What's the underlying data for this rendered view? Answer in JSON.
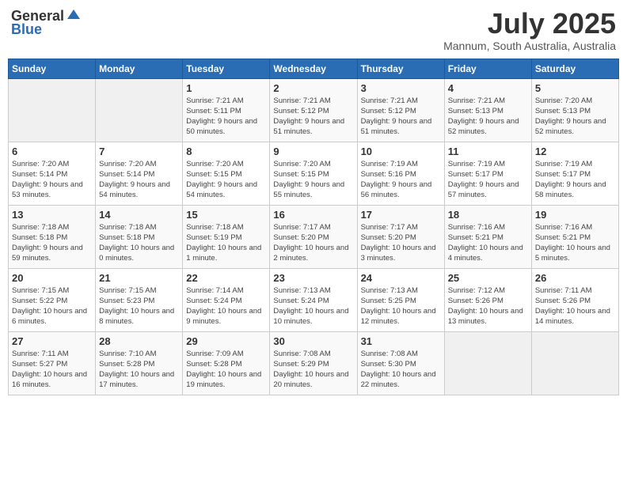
{
  "header": {
    "logo_general": "General",
    "logo_blue": "Blue",
    "month_year": "July 2025",
    "location": "Mannum, South Australia, Australia"
  },
  "days_of_week": [
    "Sunday",
    "Monday",
    "Tuesday",
    "Wednesday",
    "Thursday",
    "Friday",
    "Saturday"
  ],
  "weeks": [
    [
      {
        "day": "",
        "sunrise": "",
        "sunset": "",
        "daylight": "",
        "empty": true
      },
      {
        "day": "",
        "sunrise": "",
        "sunset": "",
        "daylight": "",
        "empty": true
      },
      {
        "day": "1",
        "sunrise": "Sunrise: 7:21 AM",
        "sunset": "Sunset: 5:11 PM",
        "daylight": "Daylight: 9 hours and 50 minutes.",
        "empty": false
      },
      {
        "day": "2",
        "sunrise": "Sunrise: 7:21 AM",
        "sunset": "Sunset: 5:12 PM",
        "daylight": "Daylight: 9 hours and 51 minutes.",
        "empty": false
      },
      {
        "day": "3",
        "sunrise": "Sunrise: 7:21 AM",
        "sunset": "Sunset: 5:12 PM",
        "daylight": "Daylight: 9 hours and 51 minutes.",
        "empty": false
      },
      {
        "day": "4",
        "sunrise": "Sunrise: 7:21 AM",
        "sunset": "Sunset: 5:13 PM",
        "daylight": "Daylight: 9 hours and 52 minutes.",
        "empty": false
      },
      {
        "day": "5",
        "sunrise": "Sunrise: 7:20 AM",
        "sunset": "Sunset: 5:13 PM",
        "daylight": "Daylight: 9 hours and 52 minutes.",
        "empty": false
      }
    ],
    [
      {
        "day": "6",
        "sunrise": "Sunrise: 7:20 AM",
        "sunset": "Sunset: 5:14 PM",
        "daylight": "Daylight: 9 hours and 53 minutes.",
        "empty": false
      },
      {
        "day": "7",
        "sunrise": "Sunrise: 7:20 AM",
        "sunset": "Sunset: 5:14 PM",
        "daylight": "Daylight: 9 hours and 54 minutes.",
        "empty": false
      },
      {
        "day": "8",
        "sunrise": "Sunrise: 7:20 AM",
        "sunset": "Sunset: 5:15 PM",
        "daylight": "Daylight: 9 hours and 54 minutes.",
        "empty": false
      },
      {
        "day": "9",
        "sunrise": "Sunrise: 7:20 AM",
        "sunset": "Sunset: 5:15 PM",
        "daylight": "Daylight: 9 hours and 55 minutes.",
        "empty": false
      },
      {
        "day": "10",
        "sunrise": "Sunrise: 7:19 AM",
        "sunset": "Sunset: 5:16 PM",
        "daylight": "Daylight: 9 hours and 56 minutes.",
        "empty": false
      },
      {
        "day": "11",
        "sunrise": "Sunrise: 7:19 AM",
        "sunset": "Sunset: 5:17 PM",
        "daylight": "Daylight: 9 hours and 57 minutes.",
        "empty": false
      },
      {
        "day": "12",
        "sunrise": "Sunrise: 7:19 AM",
        "sunset": "Sunset: 5:17 PM",
        "daylight": "Daylight: 9 hours and 58 minutes.",
        "empty": false
      }
    ],
    [
      {
        "day": "13",
        "sunrise": "Sunrise: 7:18 AM",
        "sunset": "Sunset: 5:18 PM",
        "daylight": "Daylight: 9 hours and 59 minutes.",
        "empty": false
      },
      {
        "day": "14",
        "sunrise": "Sunrise: 7:18 AM",
        "sunset": "Sunset: 5:18 PM",
        "daylight": "Daylight: 10 hours and 0 minutes.",
        "empty": false
      },
      {
        "day": "15",
        "sunrise": "Sunrise: 7:18 AM",
        "sunset": "Sunset: 5:19 PM",
        "daylight": "Daylight: 10 hours and 1 minute.",
        "empty": false
      },
      {
        "day": "16",
        "sunrise": "Sunrise: 7:17 AM",
        "sunset": "Sunset: 5:20 PM",
        "daylight": "Daylight: 10 hours and 2 minutes.",
        "empty": false
      },
      {
        "day": "17",
        "sunrise": "Sunrise: 7:17 AM",
        "sunset": "Sunset: 5:20 PM",
        "daylight": "Daylight: 10 hours and 3 minutes.",
        "empty": false
      },
      {
        "day": "18",
        "sunrise": "Sunrise: 7:16 AM",
        "sunset": "Sunset: 5:21 PM",
        "daylight": "Daylight: 10 hours and 4 minutes.",
        "empty": false
      },
      {
        "day": "19",
        "sunrise": "Sunrise: 7:16 AM",
        "sunset": "Sunset: 5:21 PM",
        "daylight": "Daylight: 10 hours and 5 minutes.",
        "empty": false
      }
    ],
    [
      {
        "day": "20",
        "sunrise": "Sunrise: 7:15 AM",
        "sunset": "Sunset: 5:22 PM",
        "daylight": "Daylight: 10 hours and 6 minutes.",
        "empty": false
      },
      {
        "day": "21",
        "sunrise": "Sunrise: 7:15 AM",
        "sunset": "Sunset: 5:23 PM",
        "daylight": "Daylight: 10 hours and 8 minutes.",
        "empty": false
      },
      {
        "day": "22",
        "sunrise": "Sunrise: 7:14 AM",
        "sunset": "Sunset: 5:24 PM",
        "daylight": "Daylight: 10 hours and 9 minutes.",
        "empty": false
      },
      {
        "day": "23",
        "sunrise": "Sunrise: 7:13 AM",
        "sunset": "Sunset: 5:24 PM",
        "daylight": "Daylight: 10 hours and 10 minutes.",
        "empty": false
      },
      {
        "day": "24",
        "sunrise": "Sunrise: 7:13 AM",
        "sunset": "Sunset: 5:25 PM",
        "daylight": "Daylight: 10 hours and 12 minutes.",
        "empty": false
      },
      {
        "day": "25",
        "sunrise": "Sunrise: 7:12 AM",
        "sunset": "Sunset: 5:26 PM",
        "daylight": "Daylight: 10 hours and 13 minutes.",
        "empty": false
      },
      {
        "day": "26",
        "sunrise": "Sunrise: 7:11 AM",
        "sunset": "Sunset: 5:26 PM",
        "daylight": "Daylight: 10 hours and 14 minutes.",
        "empty": false
      }
    ],
    [
      {
        "day": "27",
        "sunrise": "Sunrise: 7:11 AM",
        "sunset": "Sunset: 5:27 PM",
        "daylight": "Daylight: 10 hours and 16 minutes.",
        "empty": false
      },
      {
        "day": "28",
        "sunrise": "Sunrise: 7:10 AM",
        "sunset": "Sunset: 5:28 PM",
        "daylight": "Daylight: 10 hours and 17 minutes.",
        "empty": false
      },
      {
        "day": "29",
        "sunrise": "Sunrise: 7:09 AM",
        "sunset": "Sunset: 5:28 PM",
        "daylight": "Daylight: 10 hours and 19 minutes.",
        "empty": false
      },
      {
        "day": "30",
        "sunrise": "Sunrise: 7:08 AM",
        "sunset": "Sunset: 5:29 PM",
        "daylight": "Daylight: 10 hours and 20 minutes.",
        "empty": false
      },
      {
        "day": "31",
        "sunrise": "Sunrise: 7:08 AM",
        "sunset": "Sunset: 5:30 PM",
        "daylight": "Daylight: 10 hours and 22 minutes.",
        "empty": false
      },
      {
        "day": "",
        "sunrise": "",
        "sunset": "",
        "daylight": "",
        "empty": true
      },
      {
        "day": "",
        "sunrise": "",
        "sunset": "",
        "daylight": "",
        "empty": true
      }
    ]
  ],
  "colors": {
    "header_bg": "#2a6db5",
    "header_text": "#ffffff",
    "odd_row": "#f9f9f9",
    "even_row": "#ffffff",
    "empty_cell": "#f0f0f0"
  }
}
